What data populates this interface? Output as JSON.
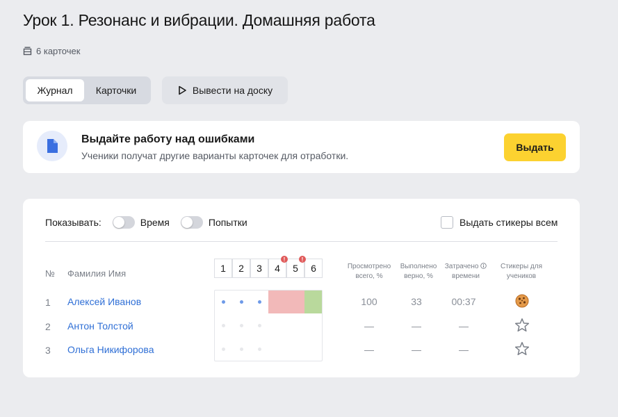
{
  "page": {
    "title": "Урок 1. Резонанс и вибрации. Домашняя работа",
    "cards_count": "6 карточек"
  },
  "tabs": {
    "journal": "Журнал",
    "cards": "Карточки"
  },
  "board_button": "Вывести на доску",
  "banner": {
    "title": "Выдайте работу над ошибками",
    "subtitle": "Ученики получат другие варианты карточек для отработки.",
    "button": "Выдать"
  },
  "journal": {
    "show_label": "Показывать:",
    "toggle_time": "Время",
    "toggle_attempts": "Попытки",
    "stickers_all": "Выдать стикеры всем",
    "headers": {
      "num": "№",
      "name": "Фамилия Имя",
      "viewed_1": "Просмотрено",
      "viewed_2": "всего, %",
      "correct_1": "Выполнено",
      "correct_2": "верно, %",
      "spent_1": "Затрачено",
      "spent_2": "времени",
      "stickers_1": "Стикеры для",
      "stickers_2": "учеников"
    },
    "card_numbers": [
      "1",
      "2",
      "3",
      "4",
      "5",
      "6"
    ],
    "rows": [
      {
        "num": "1",
        "name": "Алексей Иванов",
        "viewed": "100",
        "correct": "33",
        "spent": "00:37"
      },
      {
        "num": "2",
        "name": "Антон Толстой",
        "viewed": "—",
        "correct": "—",
        "spent": "—"
      },
      {
        "num": "3",
        "name": "Ольга Никифорова",
        "viewed": "—",
        "correct": "—",
        "spent": "—"
      }
    ]
  },
  "colors": {
    "accent_yellow": "#fcd230",
    "link_blue": "#2f6fd6",
    "wrong": "#f2b9b9",
    "right": "#b9d99c",
    "alert": "#e05a5a"
  }
}
